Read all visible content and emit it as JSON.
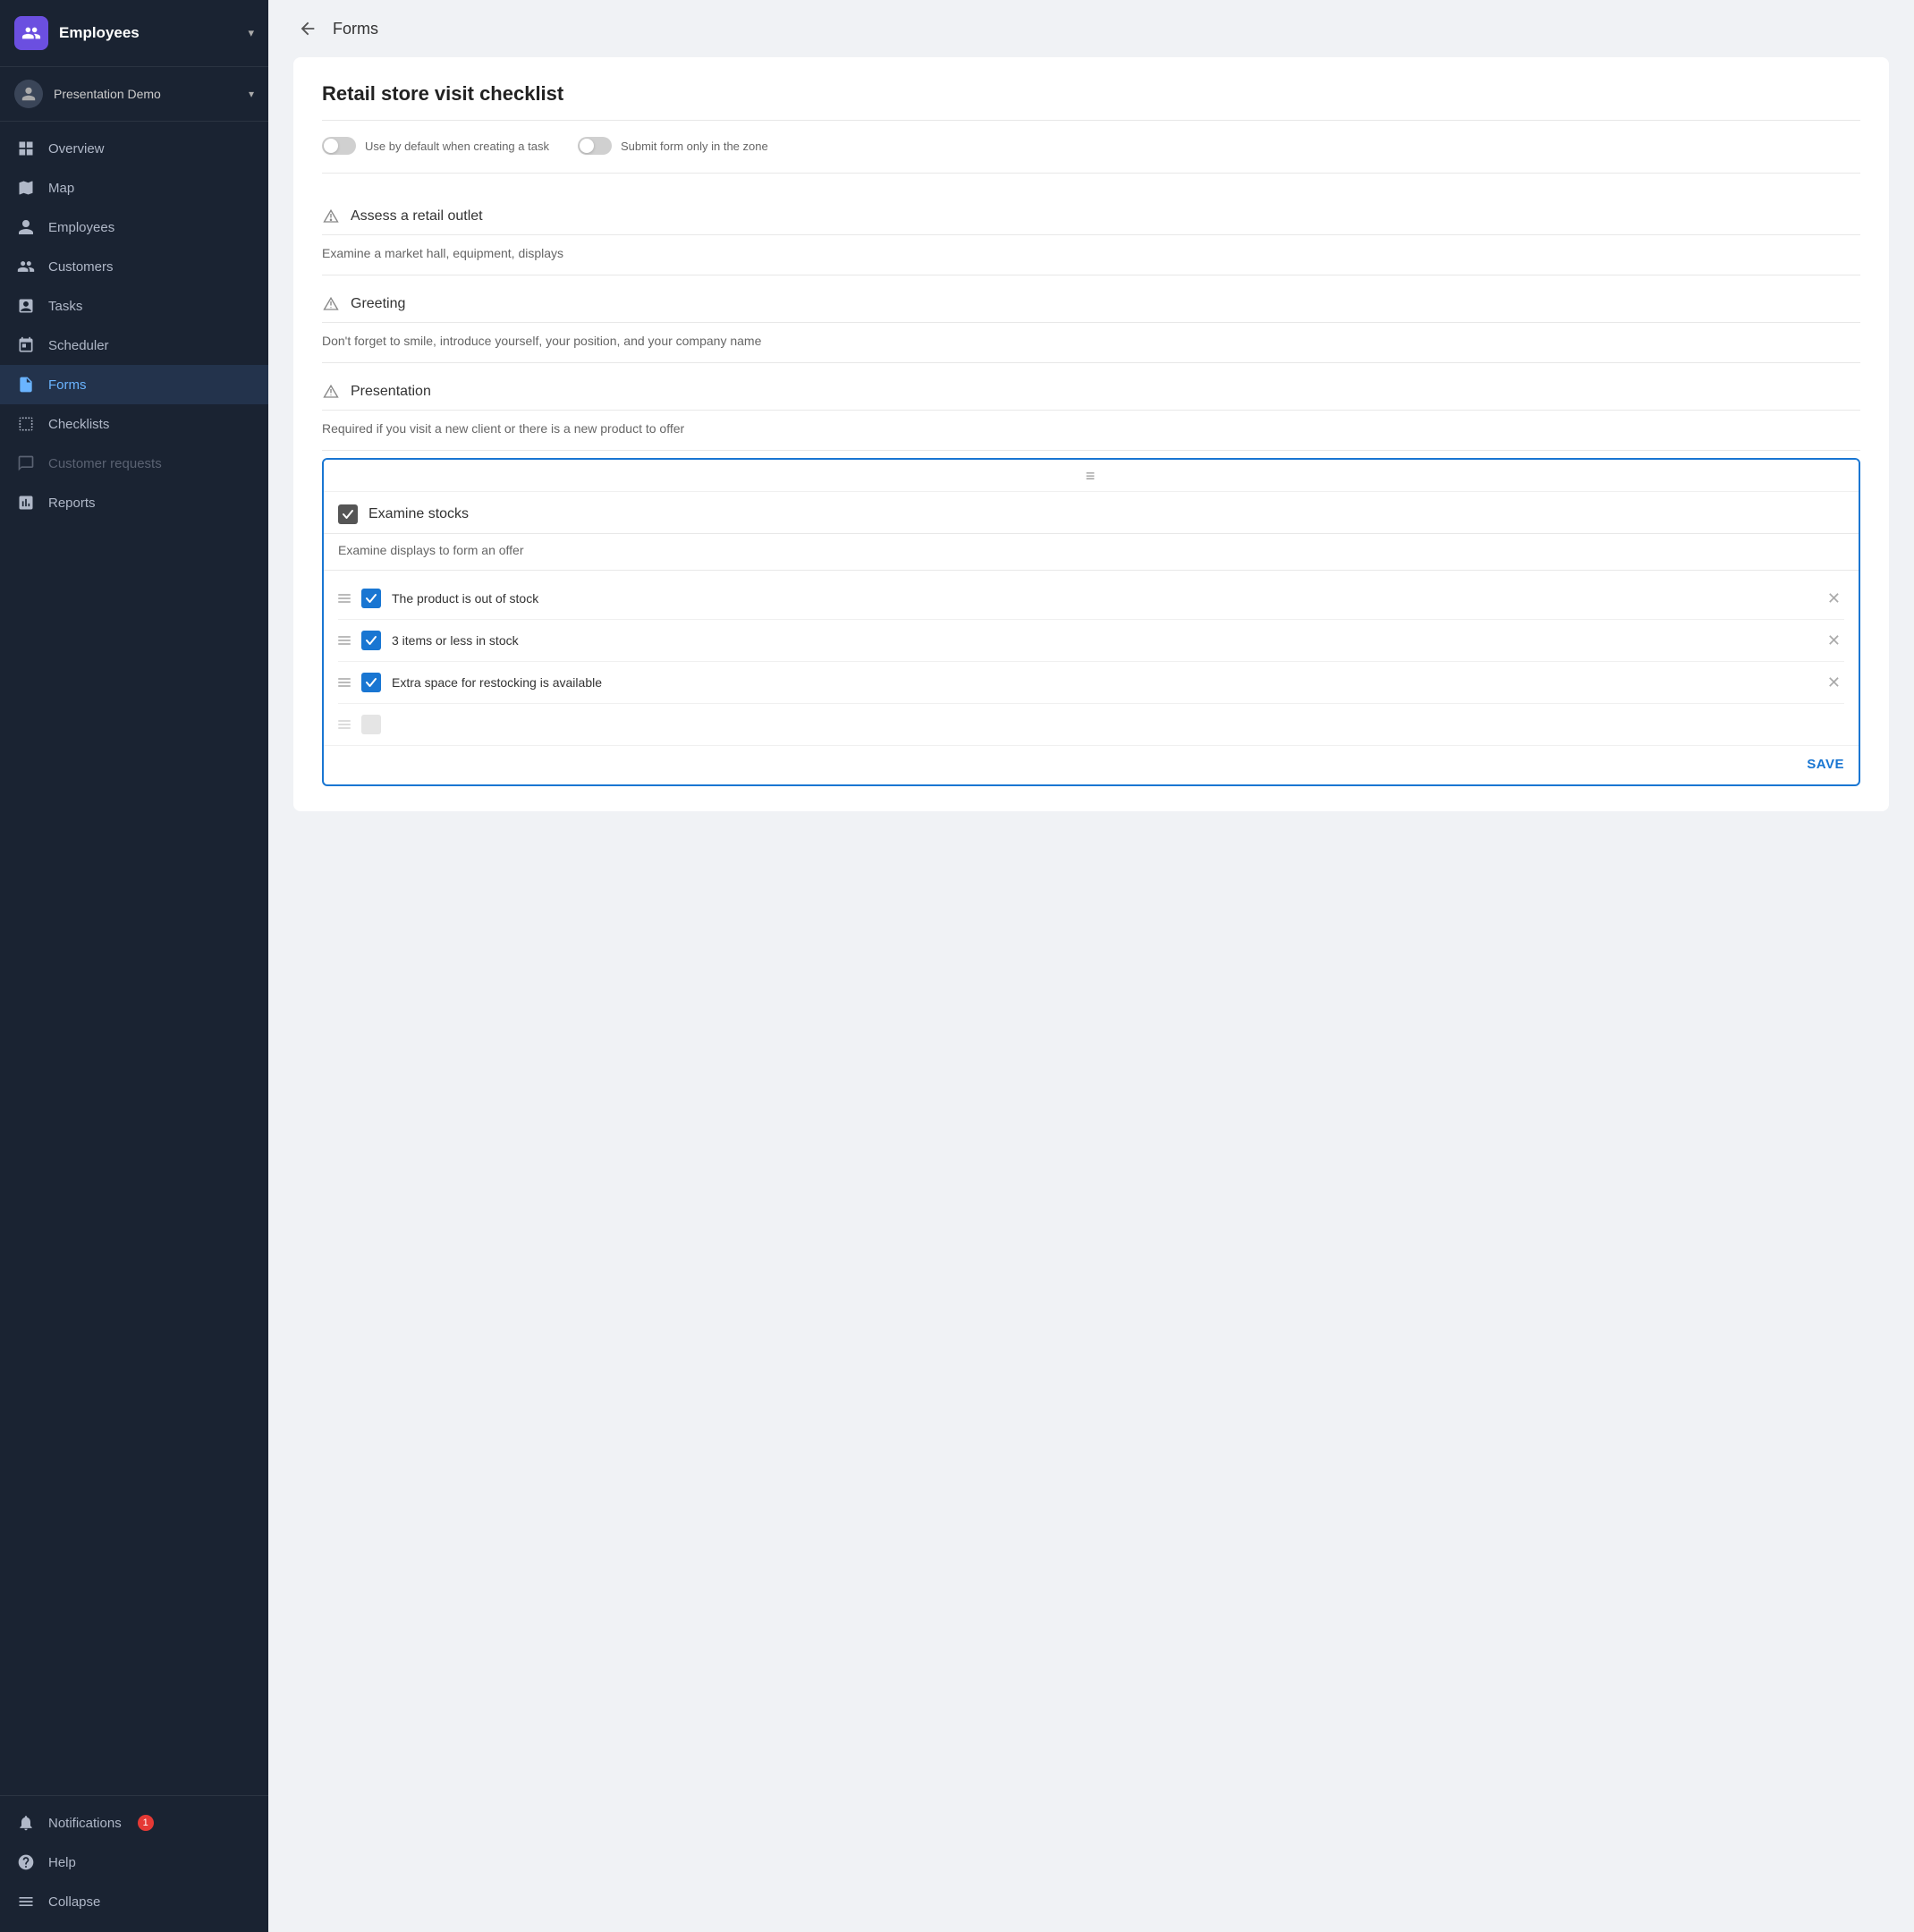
{
  "sidebar": {
    "header": {
      "title": "Employees",
      "chevron": "▾"
    },
    "user": {
      "name": "Presentation Demo",
      "chevron": "▾"
    },
    "nav_items": [
      {
        "id": "overview",
        "label": "Overview",
        "icon": "grid"
      },
      {
        "id": "map",
        "label": "Map",
        "icon": "map"
      },
      {
        "id": "employees",
        "label": "Employees",
        "icon": "person"
      },
      {
        "id": "customers",
        "label": "Customers",
        "icon": "group"
      },
      {
        "id": "tasks",
        "label": "Tasks",
        "icon": "task"
      },
      {
        "id": "scheduler",
        "label": "Scheduler",
        "icon": "calendar"
      },
      {
        "id": "forms",
        "label": "Forms",
        "icon": "form",
        "active": true
      },
      {
        "id": "checklists",
        "label": "Checklists",
        "icon": "checklist"
      },
      {
        "id": "customer-requests",
        "label": "Customer requests",
        "icon": "requests",
        "disabled": true
      },
      {
        "id": "reports",
        "label": "Reports",
        "icon": "reports"
      }
    ],
    "bottom_items": [
      {
        "id": "notifications",
        "label": "Notifications",
        "icon": "bell",
        "badge": "1"
      },
      {
        "id": "help",
        "label": "Help",
        "icon": "help"
      },
      {
        "id": "collapse",
        "label": "Collapse",
        "icon": "collapse"
      }
    ]
  },
  "header": {
    "back_label": "←",
    "title": "Forms"
  },
  "form": {
    "title": "Retail store visit checklist",
    "toggle1_label": "Use by default when creating a task",
    "toggle2_label": "Submit form only in the zone",
    "sections": [
      {
        "id": "assess",
        "title": "Assess a retail outlet",
        "description": "Examine a market hall, equipment, displays"
      },
      {
        "id": "greeting",
        "title": "Greeting",
        "description": "Don't forget to smile, introduce yourself, your position, and your company name"
      },
      {
        "id": "presentation",
        "title": "Presentation",
        "description": "Required if you visit a new client or there is a new product to offer"
      }
    ],
    "active_section": {
      "title": "Examine stocks",
      "description": "Examine displays to form an offer",
      "items": [
        {
          "id": "item1",
          "label": "The product is out of stock",
          "checked": true
        },
        {
          "id": "item2",
          "label": "3 items or less in stock",
          "checked": true
        },
        {
          "id": "item3",
          "label": "Extra space for restocking is available",
          "checked": true
        }
      ],
      "save_label": "SAVE"
    }
  }
}
